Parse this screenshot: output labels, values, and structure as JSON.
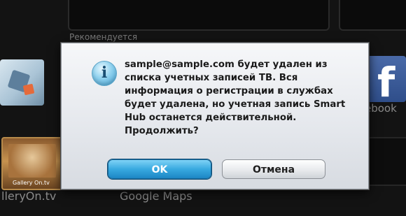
{
  "background": {
    "section_label": "Рекомендуется",
    "tiles": {
      "facebook_letter": "f",
      "facebook_caption": "ebook",
      "gallery_badge": "Gallery On.tv",
      "gallery_caption": "lleryOn.tv",
      "maps_caption": "Google Maps"
    }
  },
  "dialog": {
    "icon": "info-icon",
    "message": "sample@sample.com будет удален из\nсписка учетных записей ТВ. Вся\nинформация о регистрации в службах\nбудет удалена, но учетная запись Smart\nHub останется действительной.\nПродолжить?",
    "ok_label": "OK",
    "cancel_label": "Отмена"
  },
  "colors": {
    "ok_button": "#38a9e0",
    "dialog_bg": "#e4e7ec",
    "screen_bg": "#131313"
  }
}
